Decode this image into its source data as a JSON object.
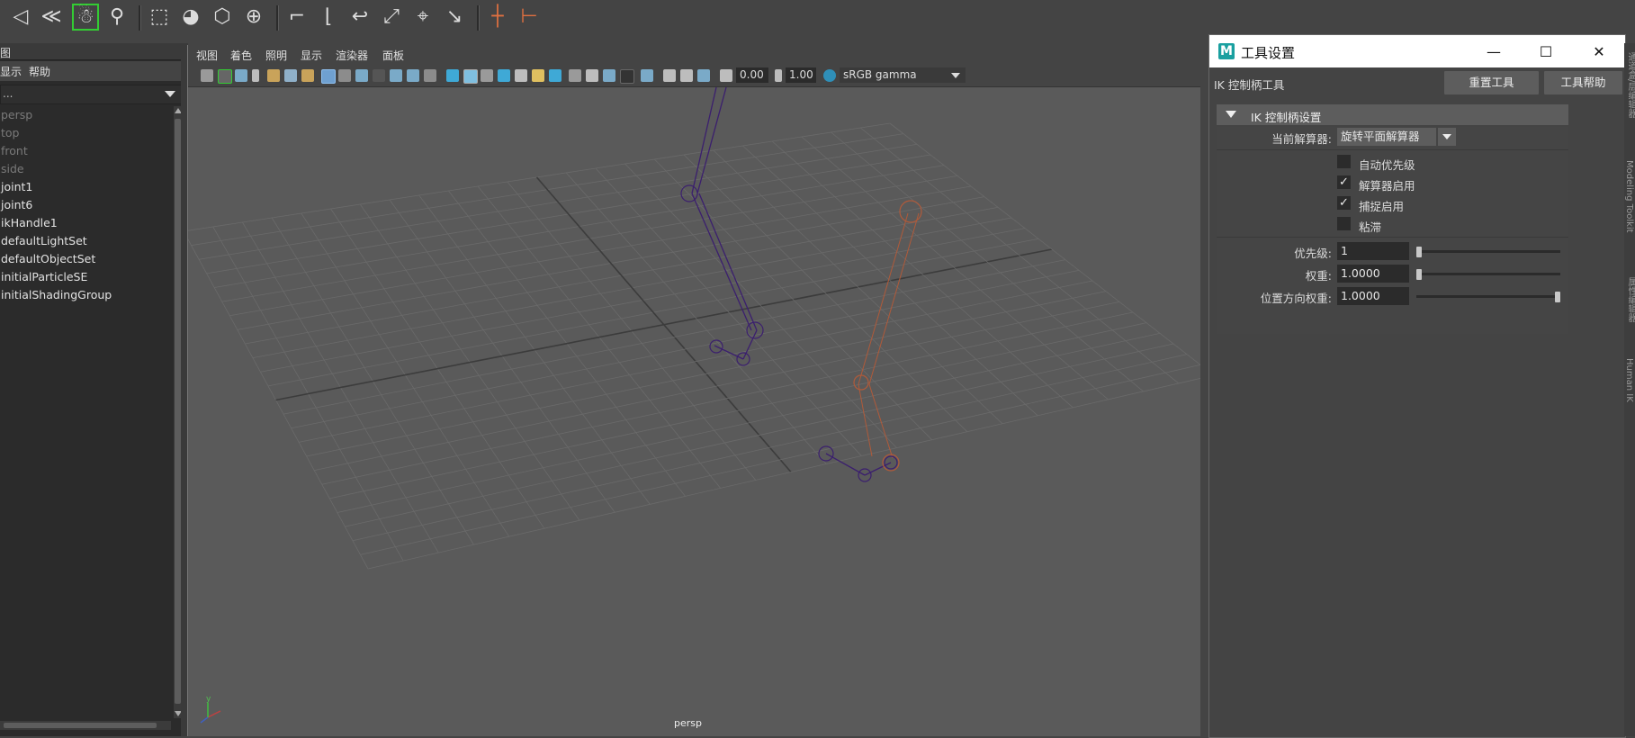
{
  "shelf": {
    "icons": [
      "ik-joint-tool-icon",
      "ik-spline-icon",
      "human-ik-icon",
      "skeleton-icon",
      "bind-skin-icon",
      "smooth-bind-icon",
      "lattice-icon",
      "cluster-icon",
      "paint-weights-icon",
      "ik-handle-icon",
      "ik-spline-handle-icon",
      "insert-joint-icon",
      "mirror-joint-icon",
      "orient-joint-icon",
      "constraint-icon",
      "aim-constraint-icon"
    ]
  },
  "outliner": {
    "tab_corner": "图",
    "menu": [
      "显示",
      "帮助"
    ],
    "filter_value": "...",
    "items": [
      {
        "label": "persp",
        "dim": true
      },
      {
        "label": "top",
        "dim": true
      },
      {
        "label": "front",
        "dim": true
      },
      {
        "label": "side",
        "dim": true
      },
      {
        "label": "joint1",
        "dim": false
      },
      {
        "label": "joint6",
        "dim": false
      },
      {
        "label": "ikHandle1",
        "dim": false
      },
      {
        "label": "defaultLightSet",
        "dim": false
      },
      {
        "label": "defaultObjectSet",
        "dim": false
      },
      {
        "label": "initialParticleSE",
        "dim": false
      },
      {
        "label": "initialShadingGroup",
        "dim": false
      }
    ]
  },
  "viewport": {
    "menu": [
      "视图",
      "着色",
      "照明",
      "显示",
      "渲染器",
      "面板"
    ],
    "exposure": "0.00",
    "gamma": "1.00",
    "color_space": "sRGB gamma",
    "camera_label": "persp",
    "axis_label": "y",
    "colors": {
      "joint_selected": "#3b1f6e",
      "joint_ghost": "#b05a3a",
      "grid_line": "#6a6a6a",
      "grid_axis": "#3c3c3c"
    }
  },
  "tool_window": {
    "title": "工具设置",
    "logo": "M",
    "tool_name": "IK 控制柄工具",
    "reset_button": "重置工具",
    "help_button": "工具帮助",
    "section": "IK 控制柄设置",
    "solver_label": "当前解算器:",
    "solver_value": "旋转平面解算器",
    "checkboxes": [
      {
        "label": "自动优先级",
        "checked": false
      },
      {
        "label": "解算器启用",
        "checked": true
      },
      {
        "label": "捕捉启用",
        "checked": true
      },
      {
        "label": "粘滞",
        "checked": false
      }
    ],
    "priority_label": "优先级:",
    "priority_value": "1",
    "weight_label": "权重:",
    "weight_value": "1.0000",
    "po_weight_label": "位置方向权重:",
    "po_weight_value": "1.0000",
    "sliders": {
      "priority": 0.0,
      "weight": 0.0,
      "po_weight": 1.0
    }
  },
  "side_tabs": [
    "通道盒/层编辑器",
    "Modeling Toolkit",
    "属性编辑器",
    "Human IK"
  ]
}
